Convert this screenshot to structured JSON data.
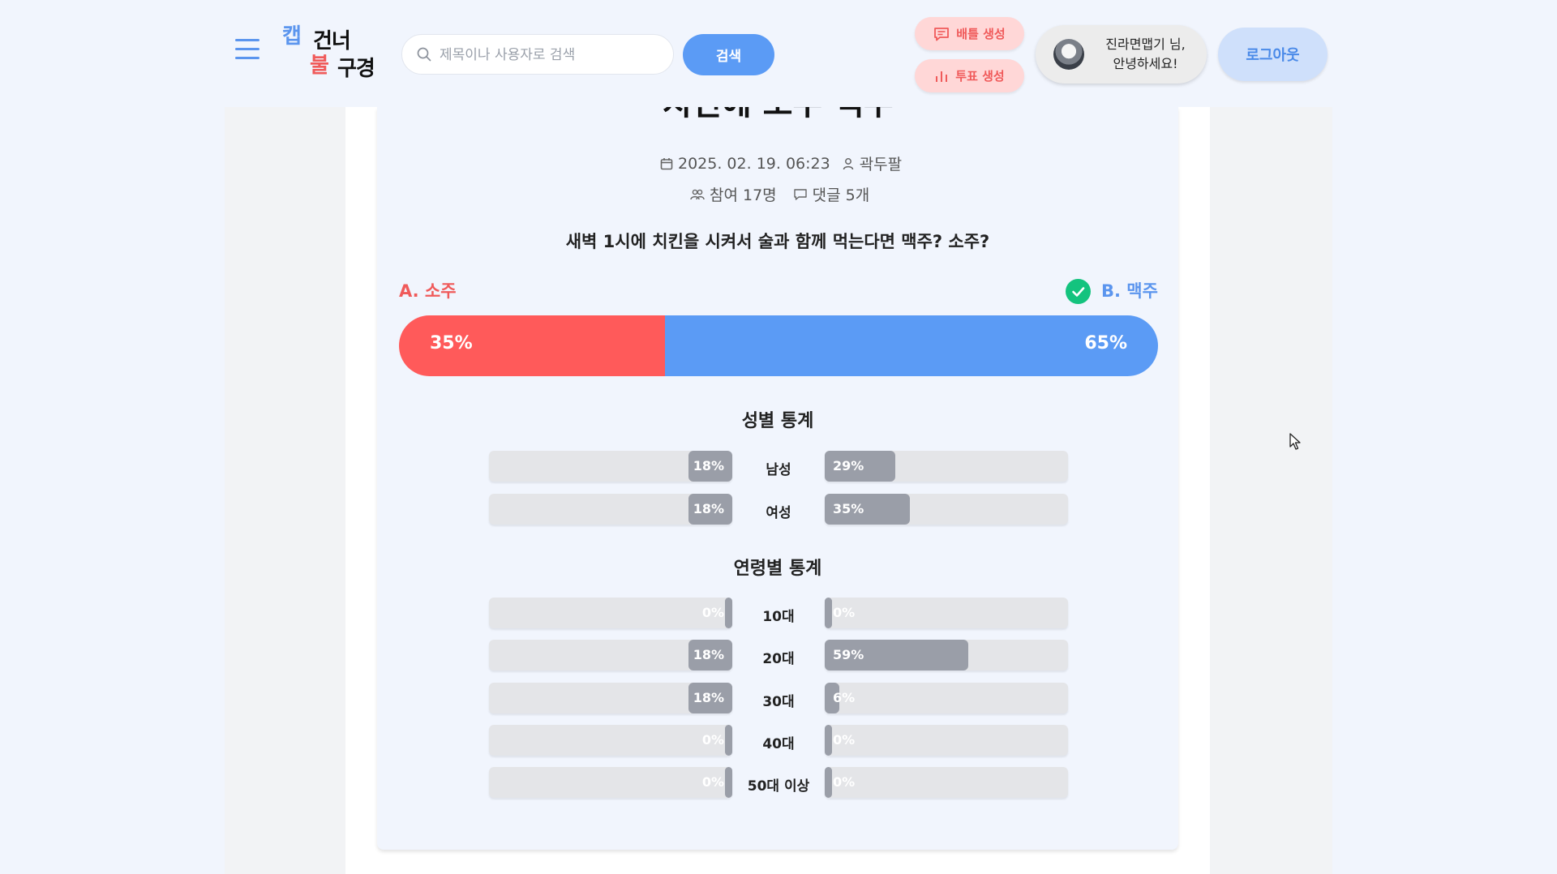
{
  "header": {
    "logo": {
      "word1": "캡",
      "word2": "건너",
      "word3": "불",
      "word4": "구경"
    },
    "search": {
      "placeholder": "제목이나 사용자로 검색",
      "button_label": "검색"
    },
    "create_battle_label": "배틀 생성",
    "create_vote_label": "투표 생성",
    "greeting_line1": "진라면맵기 님,",
    "greeting_line2": "안녕하세요!",
    "logout_label": "로그아웃"
  },
  "post": {
    "title": "치킨에 소주 맥주",
    "date": "2025. 02. 19. 06:23",
    "author": "곽두팔",
    "participants": "참여 17명",
    "comments": "댓글 5개",
    "question": "새벽 1시에 치킨을 시켜서 술과 함께 먹는다면 맥주? 소주?"
  },
  "vote": {
    "option_a": {
      "label": "A. 소주",
      "percent_label": "35%",
      "percent": 35,
      "color": "#ff5a5a"
    },
    "option_b": {
      "label": "B. 맥주",
      "percent_label": "65%",
      "percent": 65,
      "color": "#5b9bf5",
      "selected": true
    }
  },
  "gender_stats": {
    "title": "성별 통계",
    "rows": [
      {
        "label": "남성",
        "a_label": "18%",
        "a": 18,
        "b_label": "29%",
        "b": 29
      },
      {
        "label": "여성",
        "a_label": "18%",
        "a": 18,
        "b_label": "35%",
        "b": 35
      }
    ]
  },
  "age_stats": {
    "title": "연령별 통계",
    "rows": [
      {
        "label": "10대",
        "a_label": "0%",
        "a": 0,
        "b_label": "0%",
        "b": 0
      },
      {
        "label": "20대",
        "a_label": "18%",
        "a": 18,
        "b_label": "59%",
        "b": 59
      },
      {
        "label": "30대",
        "a_label": "18%",
        "a": 18,
        "b_label": "6%",
        "b": 6
      },
      {
        "label": "40대",
        "a_label": "0%",
        "a": 0,
        "b_label": "0%",
        "b": 0
      },
      {
        "label": "50대 이상",
        "a_label": "0%",
        "a": 0,
        "b_label": "0%",
        "b": 0
      }
    ]
  },
  "colors": {
    "accent_blue": "#5b9bf5",
    "accent_red": "#ff5a5a",
    "selected_green": "#14c37e",
    "stat_fill": "#9a9ea8"
  }
}
